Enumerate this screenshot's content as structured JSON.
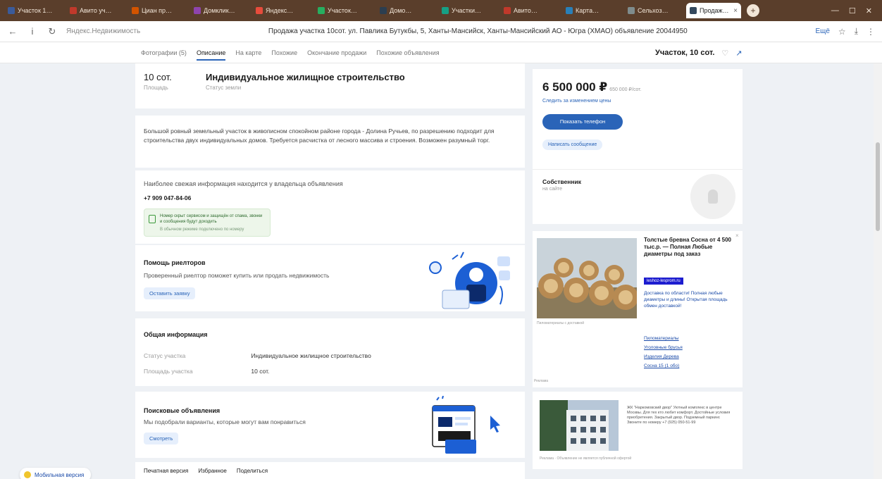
{
  "browser": {
    "tabs": [
      {
        "label": "Участок 1…",
        "color": "#3b5b9a"
      },
      {
        "label": "Авито уч…",
        "color": "#c0392b"
      },
      {
        "label": "Циан пр…",
        "color": "#d35400"
      },
      {
        "label": "Домклик…",
        "color": "#8e44ad"
      },
      {
        "label": "Яндекс…",
        "color": "#e74c3c"
      },
      {
        "label": "Участок…",
        "color": "#27ae60"
      },
      {
        "label": "Домо…",
        "color": "#2c3e50"
      },
      {
        "label": "Участки…",
        "color": "#16a085"
      },
      {
        "label": "Авито…",
        "color": "#c0392b"
      },
      {
        "label": "Карта…",
        "color": "#2980b9"
      },
      {
        "label": "Сельхоз…",
        "color": "#7f8c8d"
      },
      {
        "label": "Продаж…",
        "color": "#34495e"
      }
    ],
    "active_tab": "Продаж…",
    "new_tab": "+",
    "window_controls": [
      "—",
      "☐",
      "✕"
    ]
  },
  "addressbar": {
    "back": "←",
    "info": "i",
    "reload": "↻",
    "domain": "Яндекс.Недвижимость",
    "title": "Продажа участка 10сот. ул. Павлика Бутукбы, 5, Ханты-Мансийск, Ханты-Мансийский АО - Югра (ХМАО) объявление 20044950",
    "ext_label": "Ещё",
    "tools": [
      "☆",
      "⤓",
      "⋮"
    ]
  },
  "siteheader": {
    "tabs": [
      "Фотографии (5)",
      "Описание",
      "На карте",
      "Похожие",
      "Окончание продажи",
      "Похожие объявления"
    ],
    "active": "Описание",
    "right_label": "Участок, 10 сот.",
    "icons": [
      "♡",
      "↗"
    ]
  },
  "params": {
    "area_value": "10 сот.",
    "area_label": "Площадь",
    "status_value": "Индивидуальное жилищное строительство",
    "status_label": "Статус земли"
  },
  "description": "Большой ровный земельный участок в живописном спокойном районе города - Долина Ручьев, по разрешению подходит для строительства двух индивидуальных домов. Требуется расчистка от лесного массива и строения. Возможен разумный торг.",
  "contact": {
    "note": "Наиболее свежая информация находится у владельца объявления",
    "phone": "+7 909 047-84-06",
    "box_title": "Номер скрыт сервисом и защищён от спама, звонки и сообщения будут доходить",
    "box_sub": "В обычном режиме подключено по номеру"
  },
  "agent": {
    "title": "Помощь риелторов",
    "desc": "Проверенный риелтор поможет купить или продать недвижимость",
    "button": "Оставить заявку"
  },
  "info": {
    "title": "Общая информация",
    "rows": [
      {
        "key": "Статус участка",
        "value": "Индивидуальное жилищное строительство"
      },
      {
        "key": "Площадь участка",
        "value": "10 сот."
      }
    ]
  },
  "search": {
    "title": "Поисковые объявления",
    "desc": "Мы подобрали варианты, которые могут вам понравиться",
    "button": "Смотреть"
  },
  "bottombar": {
    "items": [
      "Печатная версия",
      "Избранное",
      "Поделиться"
    ]
  },
  "price": {
    "value": "6 500 000 ₽",
    "per_unit": "650 000 ₽/сот.",
    "history": "Следить за изменением цены",
    "phone_button": "Показать телефон",
    "message_button": "Написать сообщение"
  },
  "owner": {
    "title": "Собственник",
    "subtitle": "на сайте"
  },
  "ad": {
    "caption": "Пиломатериалы с доставкой",
    "title": "Толстые бревна Сосна от 4 500 тыс.р. — Полная Любые диаметры под заказ",
    "site": "leshoz-lesprom.ru",
    "desc": "Доставка по области! Полная любые диаметры и длины! Открытая площадь обмен доставкой!",
    "links": [
      "Пиломатериалы",
      "Уголовные брусья",
      "Изделия Дерева",
      "Сосна 15 (1 обо)"
    ],
    "close": "×",
    "ad_label": "Реклама"
  },
  "ad2": {
    "title": "ЖК \"Наркомовский двор\" Уютный комплекс в центре Москвы. Для тех кто любит комфорт. Достойные условия приобретения. Закрытый двор. Подземный паркинг. Звоните по номеру +7 (925) 050-51-99",
    "footer": "Реклама · Объявление не является публичной офертой"
  },
  "help": {
    "label": "Мобильная версия"
  }
}
